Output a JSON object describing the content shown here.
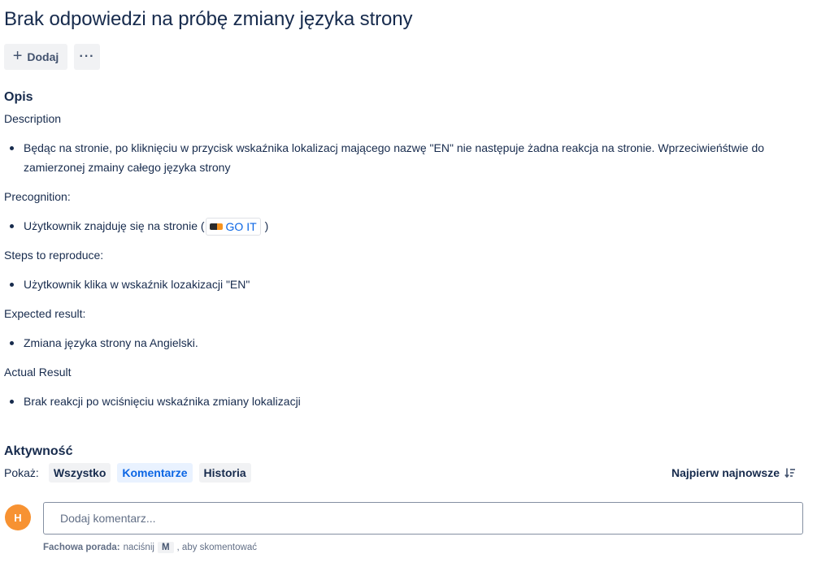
{
  "issue": {
    "title": "Brak odpowiedzi na próbę zmiany języka strony"
  },
  "toolbar": {
    "add_label": "Dodaj",
    "more_label": "···"
  },
  "description": {
    "heading": "Opis",
    "intro": "Description",
    "summary_item": "Będąc na stronie, po kliknięciu w przycisk wskaźnika lokalizacj mającego nazwę \"EN\" nie następuje żadna reakcja na stronie. Wprzeciwieńśtwie do zamierzonej zmainy całego języka strony",
    "precondition_label": "Precognition:",
    "precondition_prefix": "Użytkownik znajduję się na stronie (",
    "precondition_link": "GO IT",
    "precondition_suffix": ")",
    "steps_label": "Steps to reproduce:",
    "steps_item": "Użytkownik klika w wskaźnik lozakizacji \"EN\"",
    "expected_label": "Expected result:",
    "expected_item": "Zmiana języka strony na Angielski.",
    "actual_label": "Actual Result",
    "actual_item": "Brak reakcji po wciśnięciu wskaźnika zmiany lokalizacji"
  },
  "activity": {
    "heading": "Aktywność",
    "show_label": "Pokaż:",
    "filters": [
      "Wszystko",
      "Komentarze",
      "Historia"
    ],
    "active_filter": "Komentarze",
    "sort_label": "Najpierw najnowsze"
  },
  "comment": {
    "avatar_initial": "H",
    "placeholder": "Dodaj komentarz...",
    "tip_bold": "Fachowa porada:",
    "tip_pre": "naciśnij",
    "tip_key": "M",
    "tip_post": ", aby skomentować"
  },
  "colors": {
    "text": "#172b4d",
    "link": "#0c66e4",
    "avatar": "#f79232",
    "chip_active_bg": "#e9f2ff"
  },
  "icons": {
    "add": "plus-icon",
    "more": "more-icon",
    "sort": "sort-icon",
    "link_logo": "goit-logo-icon"
  }
}
